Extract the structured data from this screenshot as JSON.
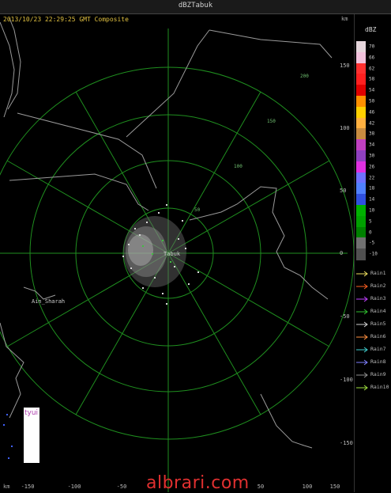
{
  "window": {
    "title": "dBZTabuk"
  },
  "radar": {
    "header": "2013/10/23 22:29:25 GMT Composite",
    "unit_top": "km",
    "unit_bottom": "km",
    "center_label": "Tabuk",
    "place_label": "Ain_Sharah",
    "x_ticks": [
      "-150",
      "-100",
      "-50",
      "50",
      "100",
      "150"
    ],
    "y_ticks": [
      "150",
      "100",
      "50",
      "0",
      "-50",
      "-100",
      "-150"
    ],
    "ring_labels": [
      "50",
      "100",
      "150",
      "200"
    ]
  },
  "legend": {
    "title": "dBZ",
    "scale": [
      {
        "label": "70",
        "color": "#e6d6dc"
      },
      {
        "label": "66",
        "color": "#f2c2dc"
      },
      {
        "label": "62",
        "color": "#ff3030"
      },
      {
        "label": "58",
        "color": "#ff2020"
      },
      {
        "label": "54",
        "color": "#e00000"
      },
      {
        "label": "50",
        "color": "#ff9000"
      },
      {
        "label": "46",
        "color": "#ffd000"
      },
      {
        "label": "42",
        "color": "#ffb040"
      },
      {
        "label": "38",
        "color": "#c88c40"
      },
      {
        "label": "34",
        "color": "#c040c0"
      },
      {
        "label": "30",
        "color": "#9040c0"
      },
      {
        "label": "26",
        "color": "#e030e0"
      },
      {
        "label": "22",
        "color": "#7070ff"
      },
      {
        "label": "18",
        "color": "#5080ff"
      },
      {
        "label": "14",
        "color": "#3050e0"
      },
      {
        "label": "10",
        "color": "#00b000"
      },
      {
        "label": "5",
        "color": "#00a000"
      },
      {
        "label": "0",
        "color": "#008000"
      },
      {
        "label": "-5",
        "color": "#707070"
      },
      {
        "label": "-10",
        "color": "#505050"
      }
    ],
    "rain": [
      {
        "label": "Rain1",
        "color": "#f0e060"
      },
      {
        "label": "Rain2",
        "color": "#ff6020"
      },
      {
        "label": "Rain3",
        "color": "#c040ff"
      },
      {
        "label": "Rain4",
        "color": "#30c030"
      },
      {
        "label": "Rain5",
        "color": "#d0d0d0"
      },
      {
        "label": "Rain6",
        "color": "#ff9040"
      },
      {
        "label": "Rain7",
        "color": "#40d0d0"
      },
      {
        "label": "Rain8",
        "color": "#8080ff"
      },
      {
        "label": "Rain9",
        "color": "#909090"
      },
      {
        "label": "Rain10",
        "color": "#a0e040"
      }
    ]
  },
  "overlay": {
    "note_text": "tyui"
  },
  "watermark": "albrari.com"
}
